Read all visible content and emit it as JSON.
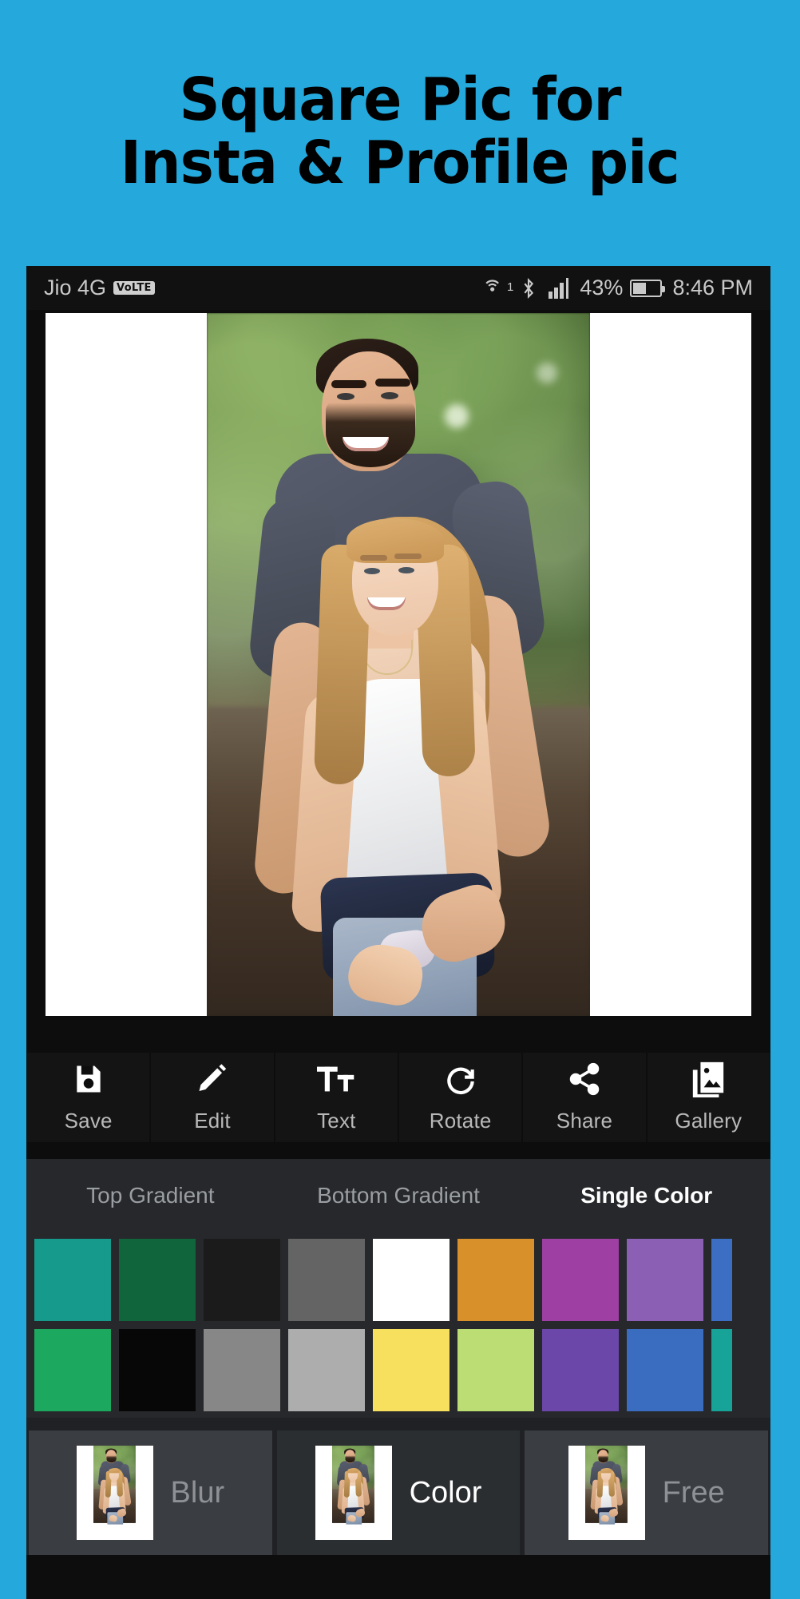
{
  "promo": {
    "line1": "Square Pic for",
    "line2": "Insta & Profile  pic",
    "background_color": "#25a8dc",
    "text_color": "#000000"
  },
  "statusbar": {
    "carrier": "Jio 4G",
    "volte_badge": "VoLTE",
    "hotspot_icon": "hotspot-icon",
    "hotspot_superscript": "1",
    "bluetooth_icon": "bluetooth-icon",
    "signal_icon": "signal-bars-icon",
    "battery_percent": "43%",
    "battery_icon": "battery-icon",
    "clock": "8:46 PM",
    "background_color": "#111112",
    "text_color": "#c9c9c9"
  },
  "canvas": {
    "background_color": "#ffffff",
    "description": "Photo of a couple in a park with white side bars"
  },
  "toolbar": {
    "items": [
      {
        "label": "Save",
        "icon": "save-floppy-icon"
      },
      {
        "label": "Edit",
        "icon": "pencil-icon"
      },
      {
        "label": "Text",
        "icon": "text-tt-icon"
      },
      {
        "label": "Rotate",
        "icon": "rotate-cw-icon"
      },
      {
        "label": "Share",
        "icon": "share-nodes-icon"
      },
      {
        "label": "Gallery",
        "icon": "gallery-image-icon"
      }
    ]
  },
  "tabs": {
    "items": [
      {
        "label": "Top Gradient",
        "active": false
      },
      {
        "label": "Bottom Gradient",
        "active": false
      },
      {
        "label": "Single Color",
        "active": true
      }
    ],
    "active_color": "#ffffff",
    "inactive_color": "#9a9da1"
  },
  "swatches": {
    "row1": [
      "#169a8c",
      "#11653c",
      "#1b1b1c",
      "#646464",
      "#ffffff",
      "#d8902a",
      "#9d3fa3",
      "#8a5fb4"
    ],
    "row1_partial": "#3c6fc4",
    "row2": [
      "#1ca95f",
      "#070707",
      "#878787",
      "#adadad",
      "#f7e05e",
      "#bcdc74",
      "#6a47a8",
      "#3a6cc0"
    ],
    "row2_partial": "#17a398"
  },
  "bottomnav": {
    "items": [
      {
        "label": "Blur",
        "active": false
      },
      {
        "label": "Color",
        "active": true
      },
      {
        "label": "Free",
        "active": false
      }
    ]
  }
}
